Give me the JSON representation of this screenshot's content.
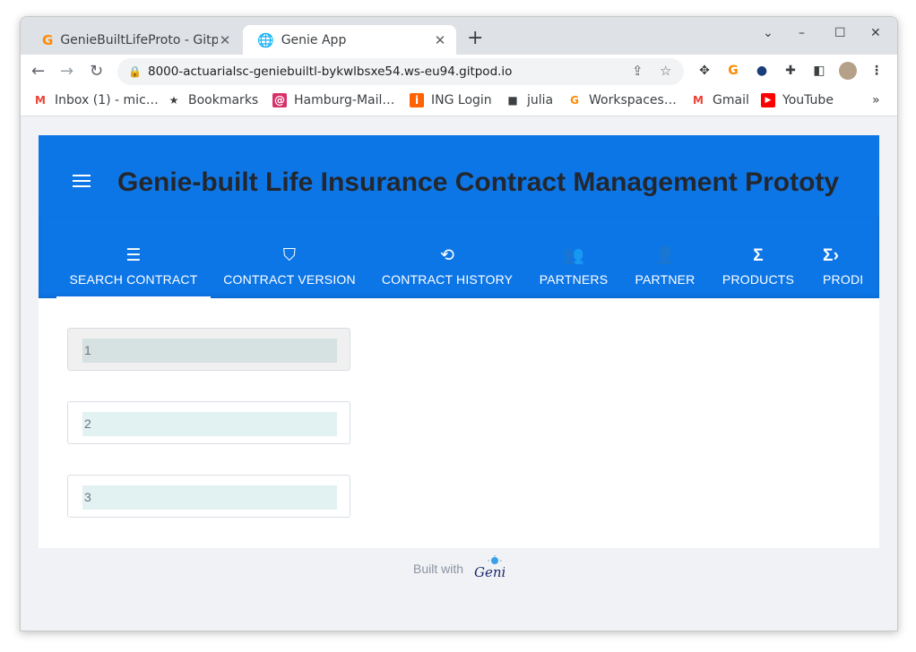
{
  "browser": {
    "tabs": [
      {
        "title": "GenieBuiltLifeProto - Gitp",
        "icon": "gitpod-icon",
        "active": false
      },
      {
        "title": "Genie App",
        "icon": "globe-icon",
        "active": true
      }
    ],
    "new_tab_label": "+",
    "window_controls": {
      "minimize": "–",
      "maximize": "☐",
      "close": "✕"
    },
    "address": "8000-actuarialsc-geniebuiltl-bykwlbsxe54.ws-eu94.gitpod.io",
    "bookmarks": [
      {
        "label": "Inbox (1) - mic…",
        "icon": "gmail-icon"
      },
      {
        "label": "Bookmarks",
        "icon": "star-icon"
      },
      {
        "label": "Hamburg-Mail…",
        "icon": "at-icon"
      },
      {
        "label": "ING Login",
        "icon": "ing-icon"
      },
      {
        "label": "julia",
        "icon": "folder-icon"
      },
      {
        "label": "Workspaces…",
        "icon": "gitpod-icon"
      },
      {
        "label": "Gmail",
        "icon": "gmail-icon"
      },
      {
        "label": "YouTube",
        "icon": "youtube-icon"
      }
    ],
    "bookmarks_overflow": "»"
  },
  "app": {
    "title": "Genie-built Life Insurance Contract Management Prototy",
    "accent_color": "#0d76e7",
    "tabs": [
      {
        "label": "SEARCH CONTRACT",
        "icon": "list-icon",
        "active": true
      },
      {
        "label": "CONTRACT VERSION",
        "icon": "verified-shield-icon"
      },
      {
        "label": "CONTRACT HISTORY",
        "icon": "history-icon"
      },
      {
        "label": "PARTNERS",
        "icon": "people-icon"
      },
      {
        "label": "PARTNER",
        "icon": "person-icon"
      },
      {
        "label": "PRODUCTS",
        "icon": "sigma-icon"
      },
      {
        "label": "PRODI",
        "icon": "sigma-arrow-icon"
      }
    ],
    "cards": [
      {
        "value": "1"
      },
      {
        "value": "2"
      },
      {
        "value": "3"
      }
    ],
    "footer": {
      "built_with": "Built with",
      "logo_text": "Genie"
    }
  }
}
